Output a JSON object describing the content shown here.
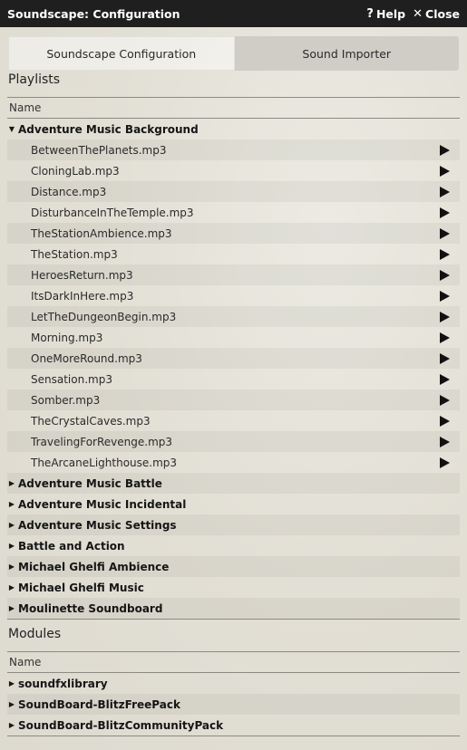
{
  "window": {
    "title": "Soundscape: Configuration",
    "help_label": "Help",
    "close_label": "Close"
  },
  "tabs": [
    {
      "label": "Soundscape Configuration",
      "active": true
    },
    {
      "label": "Sound Importer",
      "active": false
    }
  ],
  "playlists": {
    "heading": "Playlists",
    "column_header": "Name",
    "expanded_folder": {
      "label": "Adventure Music Background",
      "tracks": [
        "BetweenThePlanets.mp3",
        "CloningLab.mp3",
        "Distance.mp3",
        "DisturbanceInTheTemple.mp3",
        "TheStationAmbience.mp3",
        "TheStation.mp3",
        "HeroesReturn.mp3",
        "ItsDarkInHere.mp3",
        "LetTheDungeonBegin.mp3",
        "Morning.mp3",
        "OneMoreRound.mp3",
        "Sensation.mp3",
        "Somber.mp3",
        "TheCrystalCaves.mp3",
        "TravelingForRevenge.mp3",
        "TheArcaneLighthouse.mp3"
      ]
    },
    "collapsed_folders": [
      "Adventure Music Battle",
      "Adventure Music Incidental",
      "Adventure Music Settings",
      "Battle and Action",
      "Michael Ghelfi Ambience",
      "Michael Ghelfi Music",
      "Moulinette Soundboard"
    ]
  },
  "modules": {
    "heading": "Modules",
    "column_header": "Name",
    "items": [
      "soundfxlibrary",
      "SoundBoard-BlitzFreePack",
      "SoundBoard-BlitzCommunityPack"
    ]
  },
  "icons": {
    "help": "question-icon",
    "close": "close-x-icon",
    "expanded": "caret-down-icon",
    "collapsed": "caret-right-icon",
    "play": "play-icon"
  }
}
